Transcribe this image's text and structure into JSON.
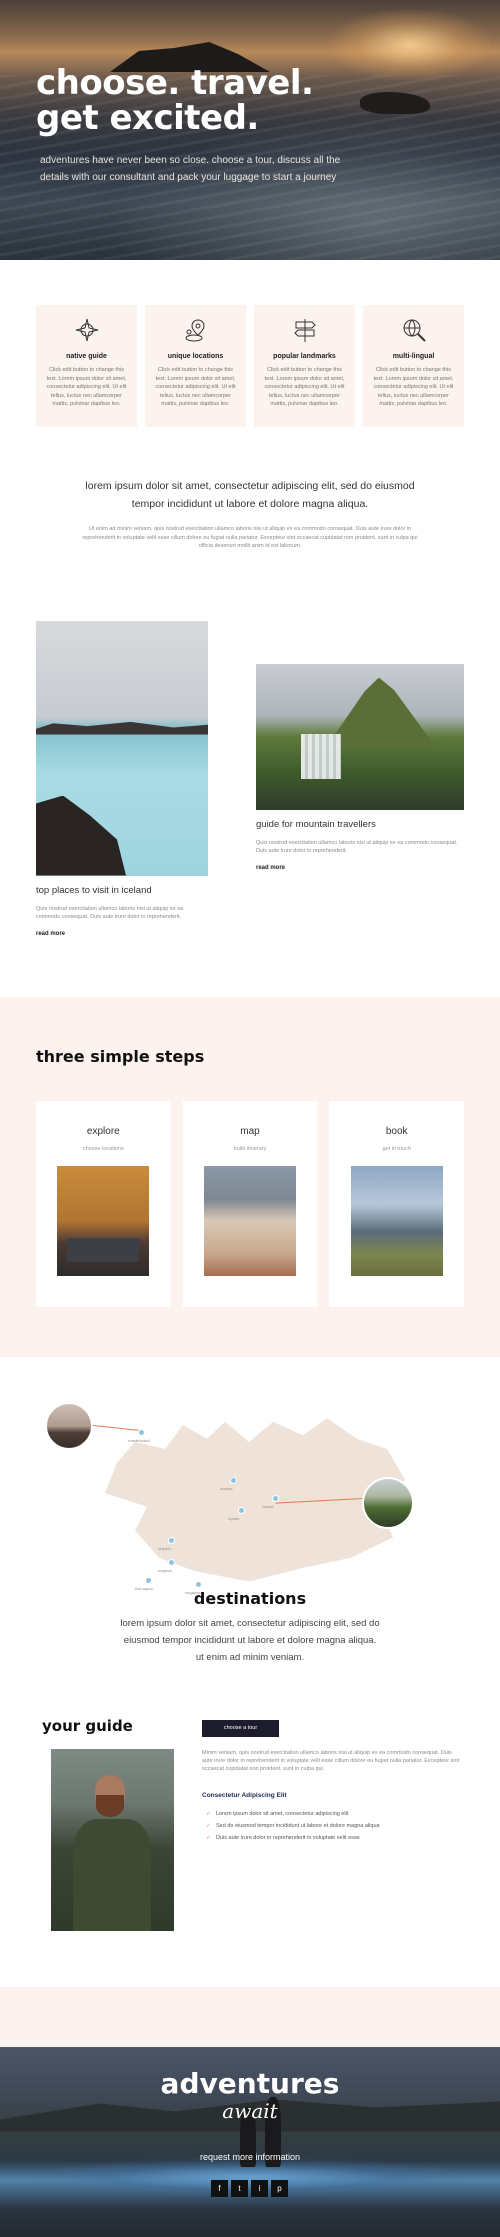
{
  "hero": {
    "title_line1": "choose. travel.",
    "title_line2": "get excited.",
    "text": "adventures have never been so close. choose a tour, discuss all the details with our consultant and pack your luggage to start a journey"
  },
  "features": [
    {
      "icon": "compass-icon",
      "title": "native guide",
      "text": "Click edit button to change this text. Lorem ipsum dolor sit amet, consectetur adipiscing elit. Ut elit tellus, luctus nec ullamcorper mattis, pulvinar dapibus leo."
    },
    {
      "icon": "location-pin-icon",
      "title": "unique locations",
      "text": "Click edit button to change this text. Lorem ipsum dolor sit amet, consectetur adipiscing elit. Ut elit tellus, luctus nec ullamcorper mattis, pulvinar dapibus leo."
    },
    {
      "icon": "signpost-icon",
      "title": "popular landmarks",
      "text": "Click edit button to change this text. Lorem ipsum dolor sit amet, consectetur adipiscing elit. Ut elit tellus, luctus nec ullamcorper mattis, pulvinar dapibus leo."
    },
    {
      "icon": "globe-search-icon",
      "title": "multi-lingual",
      "text": "Click edit button to change this text. Lorem ipsum dolor sit amet, consectetur adipiscing elit. Ut elit tellus, luctus nec ullamcorper mattis, pulvinar dapibus leo."
    }
  ],
  "intro": {
    "lead": "lorem ipsum dolor sit amet, consectetur adipiscing elit, sed do eiusmod tempor incididunt ut labore et dolore magna aliqua.",
    "small": "Ut enim ad minim veniam, quis nostrud exercitation ullamco laboris nisi ut aliquip ex ea commodo consequat. Duis aute irure dolor in reprehenderit in voluptate velit esse cillum dolore eu fugiat nulla pariatur. Excepteur sint occaecat cupidatat non proident, sunt in culpa qui officia deserunt mollit anim id est laborum."
  },
  "articles": [
    {
      "title": "top places to visit in iceland",
      "text": "Quis nostrud exercitation ullamco laboris nisi ut aliquip ex ea commodo consequat. Duis aute irure dolor in reprehenderit.",
      "read_more": "read more"
    },
    {
      "title": "guide for mountain travellers",
      "text": "Quis nostrud exercitation ullamco laboris nisi ut aliquip ex ea commodo consequat. Duis aute irure dolor in reprehenderit.",
      "read_more": "read more"
    }
  ],
  "steps": {
    "heading": "three simple steps",
    "items": [
      {
        "title": "explore",
        "sub": "choose locations"
      },
      {
        "title": "map",
        "sub": "build itinerary"
      },
      {
        "title": "book",
        "sub": "get in touch"
      }
    ]
  },
  "map": {
    "labels": [
      "snaefellsjokull",
      "reykjavik",
      "kirkjufell",
      "skogafoss",
      "vik",
      "blue lagoon",
      "akureyri",
      "husavik",
      "myvatn"
    ],
    "heading": "destinations",
    "desc": "lorem ipsum dolor sit amet, consectetur adipiscing elit, sed do eiusmod tempor incididunt ut labore et dolore magna aliqua. ut enim ad minim veniam."
  },
  "guide": {
    "heading": "your guide",
    "button": "choose a tour",
    "text": "Minim veniam, quis nostrud exercitation ullamco laboris nisi ut aliquip ex ea commodo consequat. Duis aute irure dolor in reprehenderit in voluptate velit esse cillum dolore eu fugiat nulla pariatur. Excepteur sint occaecat cupidatat non proident, sunt in culpa qui.",
    "subheading": "Consectetur Adipiscing Elit",
    "list": [
      "Lorem ipsum dolor sit amet, consectetur adipiscing elit",
      "Sed do eiusmod tempor incididunt ut labore et dolore magna aliqua",
      "Duis aute irure dolor in reprehenderit in voluptate velit esse"
    ]
  },
  "footer": {
    "title": "adventures",
    "await": "await",
    "request": "request more information",
    "social": [
      "f",
      "t",
      "i",
      "p"
    ]
  },
  "colors": {
    "accent": "#e07a4f",
    "peach": "#fcf2ee",
    "navy": "#1c1c2c",
    "map_dot": "#8fc3de"
  }
}
